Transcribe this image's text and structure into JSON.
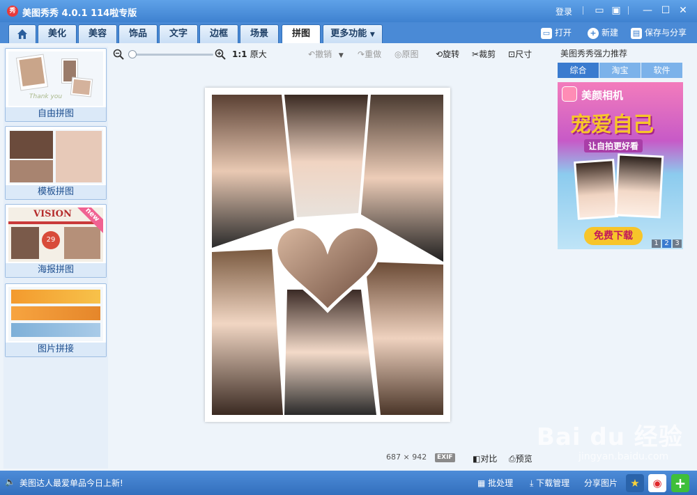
{
  "app": {
    "title": "美图秀秀 4.0.1",
    "edition": "114啦专版",
    "login": "登录"
  },
  "tabs": [
    "美化",
    "美容",
    "饰品",
    "文字",
    "边框",
    "场景",
    "拼图",
    "更多功能"
  ],
  "active_tab": "拼图",
  "header_actions": {
    "open": "打开",
    "new": "新建",
    "save_share": "保存与分享"
  },
  "left_panel": {
    "cards": [
      {
        "label": "自由拼图"
      },
      {
        "label": "模板拼图"
      },
      {
        "label": "海报拼图",
        "badge": "new",
        "thumb_text": "VISION",
        "thumb_number": "29"
      },
      {
        "label": "图片拼接"
      }
    ],
    "free_thumb_text": "Thank you"
  },
  "toolbar": {
    "ratio": "1:1",
    "original_size": "原大",
    "undo": "撤销",
    "redo": "重做",
    "original": "原图",
    "rotate": "旋转",
    "crop": "裁剪",
    "size": "尺寸"
  },
  "canvas_status": {
    "width": "687",
    "times": "×",
    "height": "942",
    "exif": "EXIF",
    "compare": "对比",
    "preview": "预览"
  },
  "right_panel": {
    "title": "美图秀秀强力推荐",
    "tabs": [
      "综合",
      "淘宝",
      "软件"
    ],
    "ad": {
      "brand": "美颜相机",
      "headline": "宠爱自己",
      "subline": "让自拍更好看",
      "button": "免费下载"
    },
    "pages": [
      "1",
      "2",
      "3"
    ],
    "active_page": "2"
  },
  "bottom_bar": {
    "news": "美图达人最爱单品今日上新!",
    "batch": "批处理",
    "download": "下载管理",
    "share": "分享图片"
  },
  "watermark": {
    "main": "Bai du 经验",
    "sub": "jingyan.baidu.com"
  },
  "colors": {
    "accent": "#3f82d0",
    "bar": "#4a8ad6",
    "ad_pink": "#f06bb0",
    "ad_yellow": "#f7c52a"
  }
}
